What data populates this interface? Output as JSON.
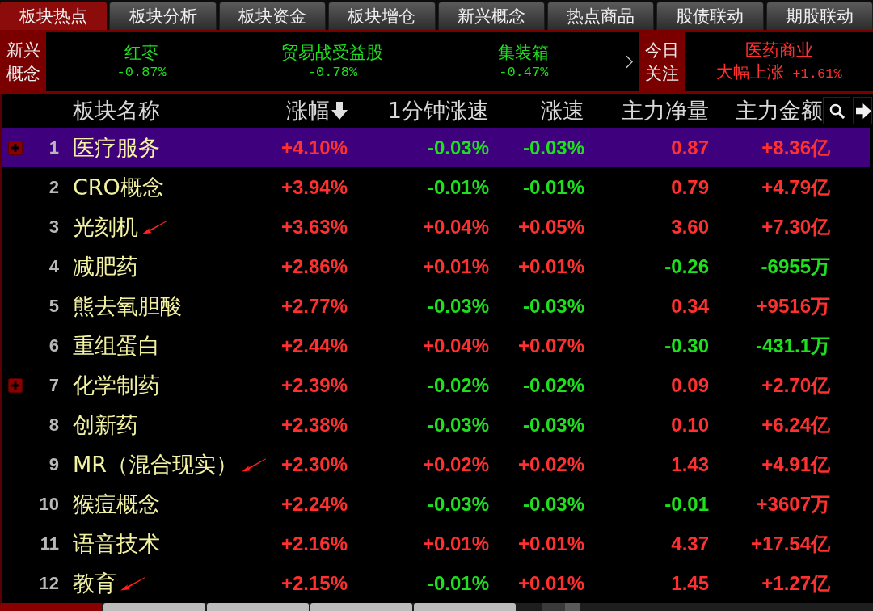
{
  "top_tabs": [
    {
      "label": "板块热点",
      "selected": true
    },
    {
      "label": "板块分析",
      "selected": false
    },
    {
      "label": "板块资金",
      "selected": false
    },
    {
      "label": "板块增仓",
      "selected": false
    },
    {
      "label": "新兴概念",
      "selected": false
    },
    {
      "label": "热点商品",
      "selected": false
    },
    {
      "label": "股债联动",
      "selected": false
    },
    {
      "label": "期股联动",
      "selected": false
    }
  ],
  "ticker": {
    "label": "新兴概念",
    "items": [
      {
        "name": "红枣",
        "change": "-0.87%",
        "rising": false
      },
      {
        "name": "贸易战受益股",
        "change": "-0.78%",
        "rising": false
      },
      {
        "name": "集装箱",
        "change": "-0.47%",
        "rising": false
      }
    ]
  },
  "focus": {
    "label": "今日关注",
    "name": "医药商业",
    "note": "大幅上涨",
    "change": "+1.61%",
    "rising": true
  },
  "table": {
    "columns": [
      {
        "label": "板块名称",
        "sorted": false
      },
      {
        "label": "涨幅",
        "sorted": true
      },
      {
        "label": "1分钟涨速",
        "sorted": false
      },
      {
        "label": "涨速",
        "sorted": false
      },
      {
        "label": "主力净量",
        "sorted": false
      },
      {
        "label": "主力金额",
        "sorted": false
      }
    ],
    "rows": [
      {
        "index": "1",
        "selected": true,
        "expandable": true,
        "annotated": false,
        "cells": [
          {
            "text": "医疗服务"
          },
          {
            "text": "+4.10%",
            "rising": true
          },
          {
            "text": "-0.03%",
            "rising": false
          },
          {
            "text": "-0.03%",
            "rising": false
          },
          {
            "text": "0.87",
            "rising": true
          },
          {
            "text": "+8.36亿",
            "rising": true
          }
        ]
      },
      {
        "index": "2",
        "selected": false,
        "expandable": false,
        "annotated": false,
        "cells": [
          {
            "text": "CRO概念"
          },
          {
            "text": "+3.94%",
            "rising": true
          },
          {
            "text": "-0.01%",
            "rising": false
          },
          {
            "text": "-0.01%",
            "rising": false
          },
          {
            "text": "0.79",
            "rising": true
          },
          {
            "text": "+4.79亿",
            "rising": true
          }
        ]
      },
      {
        "index": "3",
        "selected": false,
        "expandable": false,
        "annotated": true,
        "cells": [
          {
            "text": "光刻机"
          },
          {
            "text": "+3.63%",
            "rising": true
          },
          {
            "text": "+0.04%",
            "rising": true
          },
          {
            "text": "+0.05%",
            "rising": true
          },
          {
            "text": "3.60",
            "rising": true
          },
          {
            "text": "+7.30亿",
            "rising": true
          }
        ]
      },
      {
        "index": "4",
        "selected": false,
        "expandable": false,
        "annotated": false,
        "cells": [
          {
            "text": "减肥药"
          },
          {
            "text": "+2.86%",
            "rising": true
          },
          {
            "text": "+0.01%",
            "rising": true
          },
          {
            "text": "+0.01%",
            "rising": true
          },
          {
            "text": "-0.26",
            "rising": false
          },
          {
            "text": "-6955万",
            "rising": false
          }
        ]
      },
      {
        "index": "5",
        "selected": false,
        "expandable": false,
        "annotated": false,
        "cells": [
          {
            "text": "熊去氧胆酸"
          },
          {
            "text": "+2.77%",
            "rising": true
          },
          {
            "text": "-0.03%",
            "rising": false
          },
          {
            "text": "-0.03%",
            "rising": false
          },
          {
            "text": "0.34",
            "rising": true
          },
          {
            "text": "+9516万",
            "rising": true
          }
        ]
      },
      {
        "index": "6",
        "selected": false,
        "expandable": false,
        "annotated": false,
        "cells": [
          {
            "text": "重组蛋白"
          },
          {
            "text": "+2.44%",
            "rising": true
          },
          {
            "text": "+0.04%",
            "rising": true
          },
          {
            "text": "+0.07%",
            "rising": true
          },
          {
            "text": "-0.30",
            "rising": false
          },
          {
            "text": "-431.1万",
            "rising": false
          }
        ]
      },
      {
        "index": "7",
        "selected": false,
        "expandable": true,
        "annotated": false,
        "cells": [
          {
            "text": "化学制药"
          },
          {
            "text": "+2.39%",
            "rising": true
          },
          {
            "text": "-0.02%",
            "rising": false
          },
          {
            "text": "-0.02%",
            "rising": false
          },
          {
            "text": "0.09",
            "rising": true
          },
          {
            "text": "+2.70亿",
            "rising": true
          }
        ]
      },
      {
        "index": "8",
        "selected": false,
        "expandable": false,
        "annotated": false,
        "cells": [
          {
            "text": "创新药"
          },
          {
            "text": "+2.38%",
            "rising": true
          },
          {
            "text": "-0.03%",
            "rising": false
          },
          {
            "text": "-0.03%",
            "rising": false
          },
          {
            "text": "0.10",
            "rising": true
          },
          {
            "text": "+6.24亿",
            "rising": true
          }
        ]
      },
      {
        "index": "9",
        "selected": false,
        "expandable": false,
        "annotated": true,
        "cells": [
          {
            "text": "MR（混合现实）"
          },
          {
            "text": "+2.30%",
            "rising": true
          },
          {
            "text": "+0.02%",
            "rising": true
          },
          {
            "text": "+0.02%",
            "rising": true
          },
          {
            "text": "1.43",
            "rising": true
          },
          {
            "text": "+4.91亿",
            "rising": true
          }
        ]
      },
      {
        "index": "10",
        "selected": false,
        "expandable": false,
        "annotated": false,
        "cells": [
          {
            "text": "猴痘概念"
          },
          {
            "text": "+2.24%",
            "rising": true
          },
          {
            "text": "-0.03%",
            "rising": false
          },
          {
            "text": "-0.03%",
            "rising": false
          },
          {
            "text": "-0.01",
            "rising": false
          },
          {
            "text": "+3607万",
            "rising": true
          }
        ]
      },
      {
        "index": "11",
        "selected": false,
        "expandable": false,
        "annotated": false,
        "cells": [
          {
            "text": "语音技术"
          },
          {
            "text": "+2.16%",
            "rising": true
          },
          {
            "text": "+0.01%",
            "rising": true
          },
          {
            "text": "+0.01%",
            "rising": true
          },
          {
            "text": "4.37",
            "rising": true
          },
          {
            "text": "+17.54亿",
            "rising": true
          }
        ]
      },
      {
        "index": "12",
        "selected": false,
        "expandable": false,
        "annotated": true,
        "cells": [
          {
            "text": "教育"
          },
          {
            "text": "+2.15%",
            "rising": true
          },
          {
            "text": "-0.01%",
            "rising": false
          },
          {
            "text": "+0.01%",
            "rising": true
          },
          {
            "text": "1.45",
            "rising": true
          },
          {
            "text": "+1.27亿",
            "rising": true
          }
        ]
      }
    ]
  },
  "bottom_tabs": [
    {
      "selected": true
    },
    {
      "selected": false
    },
    {
      "selected": false
    },
    {
      "selected": false
    },
    {
      "selected": false
    }
  ]
}
